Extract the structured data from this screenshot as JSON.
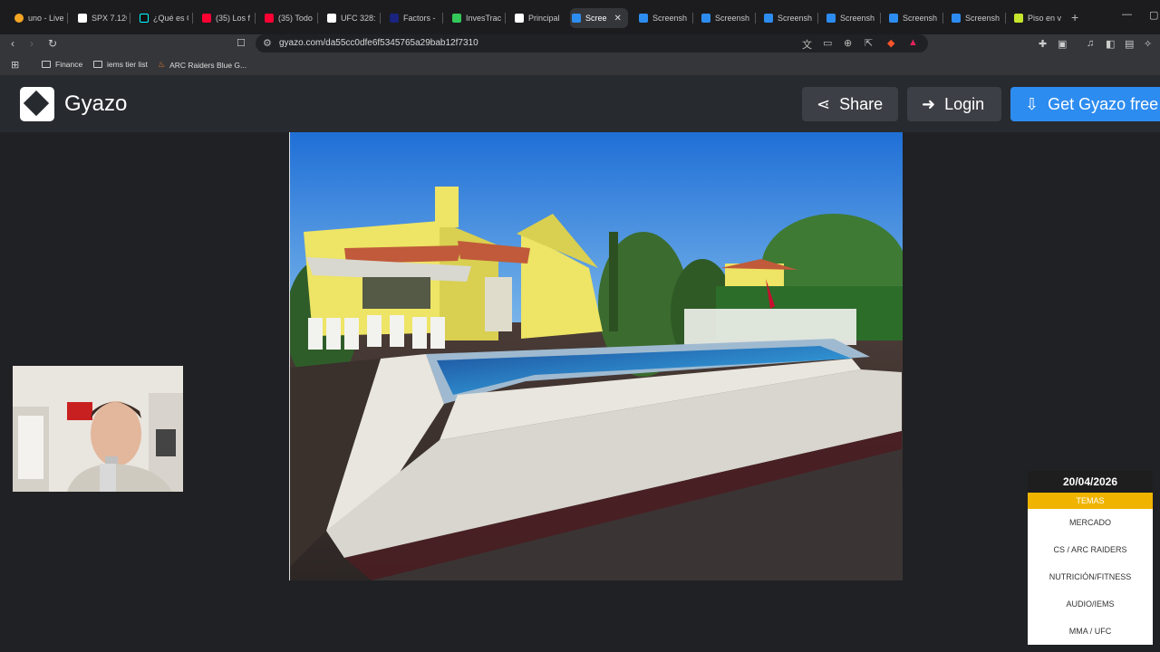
{
  "browser": {
    "tabs": [
      {
        "label": "uno - Live",
        "favicon_color": "#f5a623"
      },
      {
        "label": "SPX 7.126",
        "favicon_color": "#ffffff"
      },
      {
        "label": "¿Qué es C",
        "favicon_color": "#111111"
      },
      {
        "label": "(35) Los f",
        "favicon_color": "#ff0033"
      },
      {
        "label": "(35) Todo",
        "favicon_color": "#ff0033"
      },
      {
        "label": "UFC 328:",
        "favicon_color": "#ffffff"
      },
      {
        "label": "Factors -",
        "favicon_color": "#1a237e"
      },
      {
        "label": "InvesTrac",
        "favicon_color": "#34c759"
      },
      {
        "label": "Principal",
        "favicon_color": "#ffffff"
      },
      {
        "label": "Scree",
        "favicon_color": "#2d8cf0",
        "active": true
      },
      {
        "label": "Screensh",
        "favicon_color": "#2d8cf0"
      },
      {
        "label": "Screensh",
        "favicon_color": "#2d8cf0"
      },
      {
        "label": "Screensh",
        "favicon_color": "#2d8cf0"
      },
      {
        "label": "Screensh",
        "favicon_color": "#2d8cf0"
      },
      {
        "label": "Screensh",
        "favicon_color": "#2d8cf0"
      },
      {
        "label": "Screensh",
        "favicon_color": "#2d8cf0"
      },
      {
        "label": "Piso en v",
        "favicon_color": "#c6e62e"
      }
    ],
    "url": "gyazo.com/da55cc0dfe6f5345765a29bab12f7310",
    "bookmarks": [
      {
        "label": "Finance",
        "icon": "folder-icon"
      },
      {
        "label": "iems tier list",
        "icon": "folder-icon"
      },
      {
        "label": "ARC Raiders Blue G...",
        "icon": "flame-icon"
      }
    ]
  },
  "gyazo": {
    "logo_text": "Gyazo",
    "share_label": "Share",
    "login_label": "Login",
    "get_label": "Get Gyazo free"
  },
  "overlay": {
    "date": "20/04/2026",
    "temas_label": "TEMAS",
    "topics": [
      "MERCADO",
      "CS / ARC RAIDERS",
      "NUTRICIÓN/FITNESS",
      "AUDIO/IEMS",
      "MMA / UFC"
    ]
  }
}
